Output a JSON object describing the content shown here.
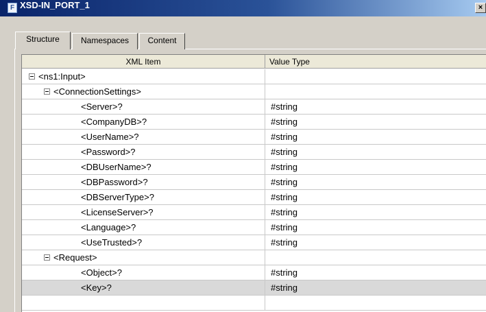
{
  "window": {
    "title": "XSD-IN_PORT_1",
    "app_icon": "F",
    "close_glyph": "×"
  },
  "tabs": [
    {
      "label": "Structure",
      "active": true
    },
    {
      "label": "Namespaces",
      "active": false
    },
    {
      "label": "Content",
      "active": false
    }
  ],
  "grid": {
    "headers": {
      "item": "XML Item",
      "type": "Value Type"
    },
    "rows": [
      {
        "item": "<ns1:Input>",
        "type": "",
        "level": 0,
        "expandable": true,
        "expanded": true
      },
      {
        "item": "<ConnectionSettings>",
        "type": "",
        "level": 1,
        "expandable": true,
        "expanded": true
      },
      {
        "item": "<Server>?",
        "type": "#string",
        "level": 2
      },
      {
        "item": "<CompanyDB>?",
        "type": "#string",
        "level": 2
      },
      {
        "item": "<UserName>?",
        "type": "#string",
        "level": 2
      },
      {
        "item": "<Password>?",
        "type": "#string",
        "level": 2
      },
      {
        "item": "<DBUserName>?",
        "type": "#string",
        "level": 2
      },
      {
        "item": "<DBPassword>?",
        "type": "#string",
        "level": 2
      },
      {
        "item": "<DBServerType>?",
        "type": "#string",
        "level": 2
      },
      {
        "item": "<LicenseServer>?",
        "type": "#string",
        "level": 2
      },
      {
        "item": "<Language>?",
        "type": "#string",
        "level": 2
      },
      {
        "item": "<UseTrusted>?",
        "type": "#string",
        "level": 2
      },
      {
        "item": "<Request>",
        "type": "",
        "level": 1,
        "expandable": true,
        "expanded": true
      },
      {
        "item": "<Object>?",
        "type": "#string",
        "level": 2
      },
      {
        "item": "<Key>?",
        "type": "#string",
        "level": 2,
        "selected": true
      },
      {
        "item": "",
        "type": "",
        "level": 0
      }
    ]
  },
  "colors": {
    "title_bar_start": "#0a246a",
    "title_bar_end": "#a6caf0",
    "dialog_background": "#d4d0c8",
    "selected_row": "#d9d9d9"
  }
}
